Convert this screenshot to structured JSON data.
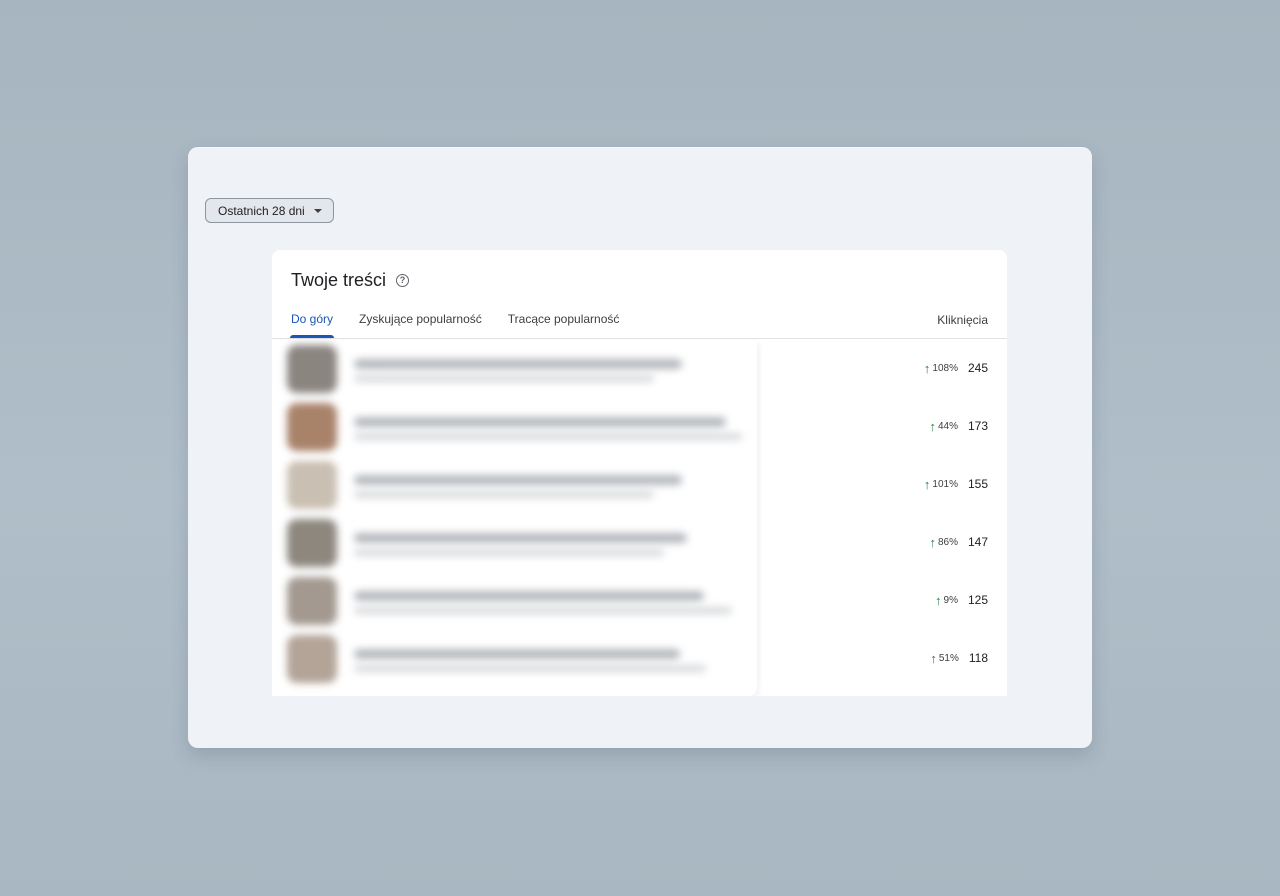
{
  "filter": {
    "label": "Ostatnich 28 dni"
  },
  "card": {
    "title": "Twoje treści",
    "tabs": [
      {
        "label": "Do góry",
        "active": true
      },
      {
        "label": "Zyskujące popularność",
        "active": false
      },
      {
        "label": "Tracące popularność",
        "active": false
      }
    ],
    "column_header": "Kliknięcia"
  },
  "rows": [
    {
      "change": "108%",
      "clicks": "245",
      "arrow": "↑"
    },
    {
      "change": "44%",
      "clicks": "173",
      "arrow": "↑"
    },
    {
      "change": "101%",
      "clicks": "155",
      "arrow": "↑"
    },
    {
      "change": "86%",
      "clicks": "147",
      "arrow": "↑"
    },
    {
      "change": "9%",
      "clicks": "125",
      "arrow": "↑"
    },
    {
      "change": "51%",
      "clicks": "118",
      "arrow": "↑"
    }
  ],
  "colors": {
    "accent": "#1a56b8",
    "trend_up": "#2a8043"
  }
}
